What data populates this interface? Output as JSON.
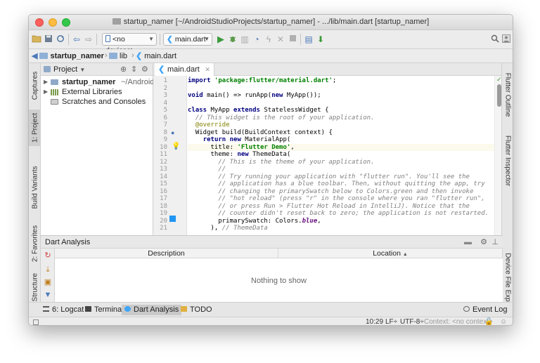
{
  "window": {
    "title": "startup_namer [~/AndroidStudioProjects/startup_namer] - .../lib/main.dart [startup_namer]"
  },
  "toolbar": {
    "device_combo": "<no devices>",
    "run_config_combo": "main.dart"
  },
  "breadcrumbs": [
    "startup_namer",
    "lib",
    "main.dart"
  ],
  "left_stripe": {
    "tabs": [
      "Captures",
      "1: Project",
      "Build Variants",
      "2: Favorites",
      "Z: Structure"
    ]
  },
  "right_stripe": {
    "tabs": [
      "Flutter Outline",
      "Flutter Inspector",
      "Device File Explorer"
    ]
  },
  "project_panel": {
    "view_combo": "Project",
    "items": [
      {
        "label": "startup_namer",
        "detail": "~/AndroidStudi"
      },
      {
        "label": "External Libraries"
      },
      {
        "label": "Scratches and Consoles"
      }
    ]
  },
  "editor": {
    "tab_label": "main.dart",
    "line_numbers": [
      "1",
      "2",
      "3",
      "4",
      "5",
      "6",
      "7",
      "8",
      "9",
      "10",
      "11",
      "12",
      "13",
      "14",
      "15",
      "16",
      "17",
      "18",
      "19",
      "20",
      "21"
    ],
    "lines": [
      [
        {
          "t": "import ",
          "c": "kw"
        },
        {
          "t": "'package:flutter/material.dart'",
          "c": "str"
        },
        {
          "t": ";",
          "c": ""
        }
      ],
      [],
      [
        {
          "t": "void ",
          "c": "kw"
        },
        {
          "t": "main() => runApp(",
          "c": ""
        },
        {
          "t": "new ",
          "c": "kw"
        },
        {
          "t": "MyApp());",
          "c": ""
        }
      ],
      [],
      [
        {
          "t": "class ",
          "c": "kw"
        },
        {
          "t": "MyApp ",
          "c": ""
        },
        {
          "t": "extends ",
          "c": "kw"
        },
        {
          "t": "StatelessWidget {",
          "c": ""
        }
      ],
      [
        {
          "t": "  // This widget is the root of your application.",
          "c": "cm"
        }
      ],
      [
        {
          "t": "  ",
          "c": ""
        },
        {
          "t": "@override",
          "c": "an"
        }
      ],
      [
        {
          "t": "  Widget build(BuildContext context) {",
          "c": ""
        }
      ],
      [
        {
          "t": "    ",
          "c": ""
        },
        {
          "t": "return new ",
          "c": "kw"
        },
        {
          "t": "MaterialApp(",
          "c": ""
        }
      ],
      [
        {
          "t": "      title: ",
          "c": ""
        },
        {
          "t": "'Flutter Demo'",
          "c": "str"
        },
        {
          "t": ",",
          "c": ""
        }
      ],
      [
        {
          "t": "      theme: ",
          "c": ""
        },
        {
          "t": "new ",
          "c": "kw"
        },
        {
          "t": "ThemeData(",
          "c": ""
        }
      ],
      [
        {
          "t": "        // This is the theme of your application.",
          "c": "cm"
        }
      ],
      [
        {
          "t": "        //",
          "c": "cm"
        }
      ],
      [
        {
          "t": "        // Try running your application with \"flutter run\". You'll see the",
          "c": "cm"
        }
      ],
      [
        {
          "t": "        // application has a blue toolbar. Then, without quitting the app, try",
          "c": "cm"
        }
      ],
      [
        {
          "t": "        // changing the primarySwatch below to Colors.green and then invoke",
          "c": "cm"
        }
      ],
      [
        {
          "t": "        // \"hot reload\" (press \"r\" in the console where you ran \"flutter run\",",
          "c": "cm"
        }
      ],
      [
        {
          "t": "        // or press Run > Flutter Hot Reload in IntelliJ). Notice that the",
          "c": "cm"
        }
      ],
      [
        {
          "t": "        // counter didn't reset back to zero; the application is not restarted.",
          "c": "cm"
        }
      ],
      [
        {
          "t": "        primarySwatch: Colors.",
          "c": ""
        },
        {
          "t": "blue",
          "c": "cst"
        },
        {
          "t": ",",
          "c": ""
        }
      ],
      [
        {
          "t": "      ), ",
          "c": ""
        },
        {
          "t": "// ThemeData",
          "c": "cm"
        }
      ]
    ]
  },
  "dart_analysis": {
    "title": "Dart Analysis",
    "columns": [
      "Description",
      "Location"
    ],
    "empty_text": "Nothing to show"
  },
  "tool_windows": [
    {
      "label": "6: Logcat"
    },
    {
      "label": "Terminal"
    },
    {
      "label": "Dart Analysis"
    },
    {
      "label": "TODO"
    }
  ],
  "event_log": "Event Log",
  "status": {
    "position": "10:29",
    "line_sep": "LF÷",
    "encoding": "UTF-8÷",
    "context": "Context: <no context>"
  },
  "colors": {
    "keyword": "#000080",
    "string": "#008000",
    "comment": "#808080",
    "annotation": "#808000",
    "constant": "#660e7a",
    "run_green": "#3c9a3c",
    "flutter_blue": "#42a5f5",
    "swatch_blue": "#2196f3"
  }
}
